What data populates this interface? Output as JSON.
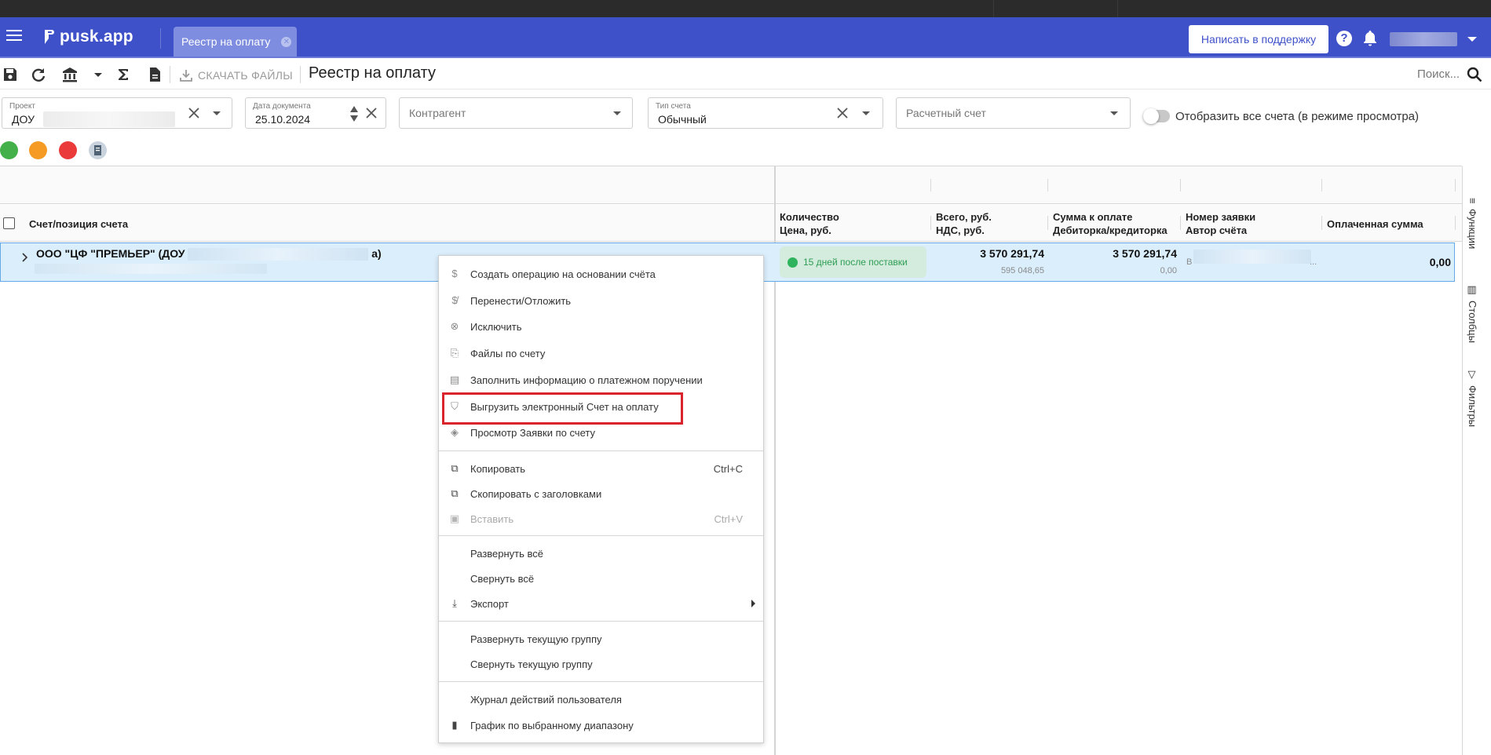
{
  "app": {
    "logo_text": "pusk.app",
    "active_tab": "Реестр на оплату",
    "support_button": "Написать в поддержку",
    "help_symbol": "?"
  },
  "toolbar": {
    "download_files": "СКАЧАТЬ ФАЙЛЫ",
    "page_title": "Реестр на оплату",
    "search_label": "Поиск..."
  },
  "filters": {
    "project": {
      "label": "Проект",
      "value": "ДОУ"
    },
    "doc_date": {
      "label": "Дата документа",
      "value": "25.10.2024"
    },
    "counterparty": {
      "placeholder": "Контрагент"
    },
    "invoice_type": {
      "label": "Тип счета",
      "value": "Обычный"
    },
    "account": {
      "placeholder": "Расчетный счет"
    },
    "show_all_toggle": {
      "label": "Отобразить все счета (в режиме просмотра)",
      "on": false
    }
  },
  "status_colors": {
    "green": "#43b04a",
    "orange": "#f59a23",
    "red": "#ea3a3a",
    "accent": "#3f51c9"
  },
  "grid": {
    "headers": {
      "invoice": "Счет/позиция счета",
      "qty_line1": "Количество",
      "qty_line2": "Цена, руб.",
      "total_line1": "Всего, руб.",
      "total_line2": "НДС, руб.",
      "pay_line1": "Сумма к оплате",
      "pay_line2": "Дебиторка/кредиторка",
      "req_line1": "Номер заявки",
      "req_line2": "Автор счёта",
      "paid": "Оплаченная сумма"
    },
    "row": {
      "title_start": "ООО \"ЦФ \"ПРЕМЬЕР\" (ДОУ",
      "title_end": "а)",
      "status": "15 дней после поставки",
      "total": "3 570 291,74",
      "vat": "595 048,65",
      "to_pay": "3 570 291,74",
      "debt": "0,00",
      "req_prefix": "В",
      "req_ellipsis": "...",
      "paid": "0,00"
    }
  },
  "side_panel": {
    "functions": "Функции",
    "columns": "Столбцы",
    "filters": "Фильтры"
  },
  "context_menu": {
    "items": [
      {
        "label": "Создать операцию на основании счёта",
        "icon": "dollar-icon"
      },
      {
        "label": "Перенести/Отложить",
        "icon": "dollar-slash-icon"
      },
      {
        "label": "Исключить",
        "icon": "close-circle-icon"
      },
      {
        "label": "Файлы по счету",
        "icon": "paperclip-icon"
      },
      {
        "label": "Заполнить информацию о платежном поручении",
        "icon": "printer-icon"
      },
      {
        "label": "Выгрузить электронный Счет на оплату",
        "icon": "shield-icon"
      },
      {
        "label": "Просмотр Заявки по счету",
        "icon": "layers-icon"
      },
      {
        "label": "Копировать",
        "shortcut": "Ctrl+C",
        "icon": "copy-icon"
      },
      {
        "label": "Скопировать с заголовками",
        "icon": "copy-icon"
      },
      {
        "label": "Вставить",
        "shortcut": "Ctrl+V",
        "icon": "clipboard-icon",
        "disabled": true
      },
      {
        "label": "Развернуть всё"
      },
      {
        "label": "Свернуть всё"
      },
      {
        "label": "Экспорт",
        "icon": "download-icon",
        "submenu": true
      },
      {
        "label": "Развернуть текущую группу"
      },
      {
        "label": "Свернуть текущую группу"
      },
      {
        "label": "Журнал действий пользователя"
      },
      {
        "label": "График по выбранному диапазону",
        "icon": "bar-chart-icon"
      }
    ]
  },
  "highlight_color": "#d9232d"
}
